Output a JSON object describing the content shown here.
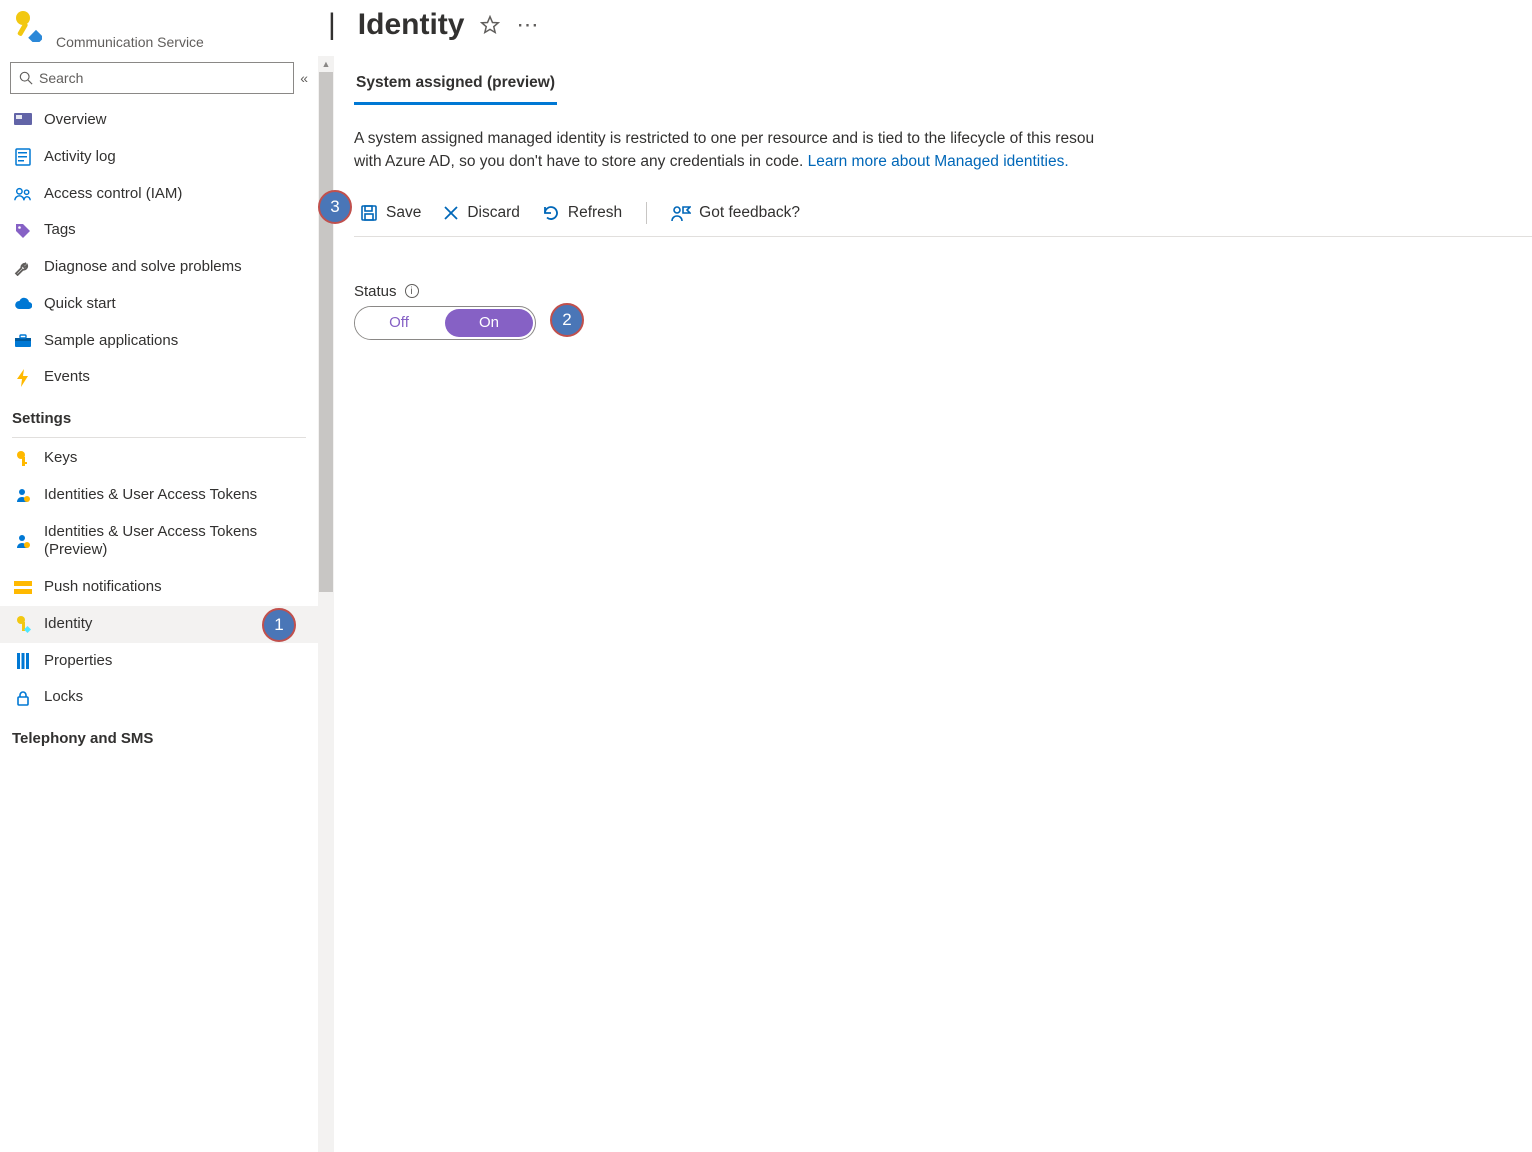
{
  "header": {
    "service_type": "Communication Service",
    "title": "Identity"
  },
  "search": {
    "placeholder": "Search"
  },
  "sidebar": {
    "groups": [
      {
        "section": null,
        "items": [
          {
            "label": "Overview"
          },
          {
            "label": "Activity log"
          },
          {
            "label": "Access control (IAM)"
          },
          {
            "label": "Tags"
          },
          {
            "label": "Diagnose and solve problems"
          },
          {
            "label": "Quick start"
          },
          {
            "label": "Sample applications"
          },
          {
            "label": "Events"
          }
        ]
      },
      {
        "section": "Settings",
        "items": [
          {
            "label": "Keys"
          },
          {
            "label": "Identities & User Access Tokens"
          },
          {
            "label": "Identities & User Access Tokens (Preview)"
          },
          {
            "label": "Push notifications"
          },
          {
            "label": "Identity",
            "selected": true
          },
          {
            "label": "Properties"
          },
          {
            "label": "Locks"
          }
        ]
      },
      {
        "section": "Telephony and SMS",
        "items": []
      }
    ]
  },
  "main": {
    "tab_label": "System assigned (preview)",
    "description_prefix": "A system assigned managed identity is restricted to one per resource and is tied to the lifecycle of this resou",
    "description_line2_prefix": "with Azure AD, so you don't have to store any credentials in code. ",
    "learn_more": "Learn more about Managed identities.",
    "toolbar": {
      "save": "Save",
      "discard": "Discard",
      "refresh": "Refresh",
      "feedback": "Got feedback?"
    },
    "status": {
      "label": "Status",
      "off": "Off",
      "on": "On",
      "value": "On"
    }
  },
  "annotations": {
    "b1": "1",
    "b2": "2",
    "b3": "3"
  }
}
